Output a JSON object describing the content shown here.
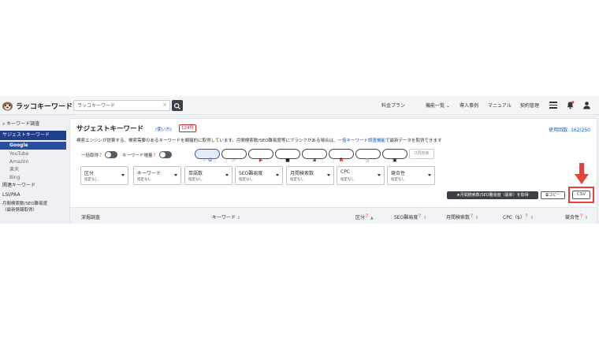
{
  "header": {
    "logo_text": "ラッコキーワード",
    "search_value": "ラッコキーワード",
    "search_clear": "×",
    "nav": [
      "料金プラン",
      "機能一覧 ⌄",
      "導入事例",
      "マニュアル",
      "契約管理"
    ]
  },
  "sidebar": {
    "items": [
      {
        "label": "キーワード調査",
        "type": "section"
      },
      {
        "label": "サジェストキーワード",
        "type": "active"
      },
      {
        "label": "Google",
        "type": "selected"
      },
      {
        "label": "YouTube",
        "type": "sub"
      },
      {
        "label": "Amazon",
        "type": "sub"
      },
      {
        "label": "楽天",
        "type": "sub"
      },
      {
        "label": "Bing",
        "type": "sub"
      },
      {
        "label": "関連キーワード",
        "type": "item"
      },
      {
        "label": "LSI/PAA",
        "type": "item"
      },
      {
        "label": "月間検索数/SEO難易度",
        "type": "item"
      },
      {
        "label": "（最新情報取得）",
        "type": "item"
      }
    ]
  },
  "main": {
    "title": "サジェストキーワード",
    "howto": "(使い方)",
    "count": "124",
    "count_unit": "件",
    "usage": "使用回数: 162/250",
    "desc_before": "検索エンジンが提案する、検索需要のあるキーワードを網羅的に取得しています。月間検索数/SEO難易度等にブランクがある場合は、",
    "desc_link": "一括キーワード調査機能",
    "desc_after": "で最新データを取得できます",
    "toggle_bulk": "一括取得",
    "toggle_kw_add": "キーワード増量",
    "engines": [
      {
        "glyph": "✓ G",
        "color": "#4285f4",
        "active": true
      },
      {
        "glyph": "▷",
        "color": "#1a9e4b",
        "active": false
      },
      {
        "glyph": "▶",
        "color": "#e52d27",
        "active": false
      },
      {
        "glyph": "■",
        "color": "#222222",
        "active": false
      },
      {
        "glyph": "a",
        "color": "#222222",
        "active": false
      },
      {
        "glyph": "R",
        "color": "#bf0000",
        "active": false
      },
      {
        "glyph": "🛒",
        "color": "#222222",
        "active": false
      },
      {
        "glyph": "▣",
        "color": "#222222",
        "active": false
      }
    ],
    "reset_label": "Q再検索",
    "filters": [
      {
        "label": "区分",
        "value": "指定なし"
      },
      {
        "label": "キーワード",
        "value": "指定なし"
      },
      {
        "label": "単語数",
        "value": "指定なし"
      },
      {
        "label": "SEO難易度",
        "value": "指定なし"
      },
      {
        "label": "月間検索数",
        "value": "指定なし"
      },
      {
        "label": "CPC",
        "value": "指定なし"
      },
      {
        "label": "競合性",
        "value": "指定なし"
      }
    ],
    "fetch_button": "★月間検索数/SEO難易度（最新）を取得",
    "copy_button": "⧉コピー",
    "csv_button": "CSV",
    "table_headers": [
      {
        "label": "深掘調査",
        "sort": ""
      },
      {
        "label": "キーワード",
        "sort": "⇕"
      },
      {
        "label": "区分",
        "sort": "▲"
      },
      {
        "label": "SEO難易度",
        "sort": "⇕"
      },
      {
        "label": "月間検索数",
        "sort": "⇕"
      },
      {
        "label": "CPC（$）",
        "sort": "⇕"
      },
      {
        "label": "競合性",
        "sort": "⇕"
      }
    ],
    "highlight_color": "#e8413c"
  }
}
